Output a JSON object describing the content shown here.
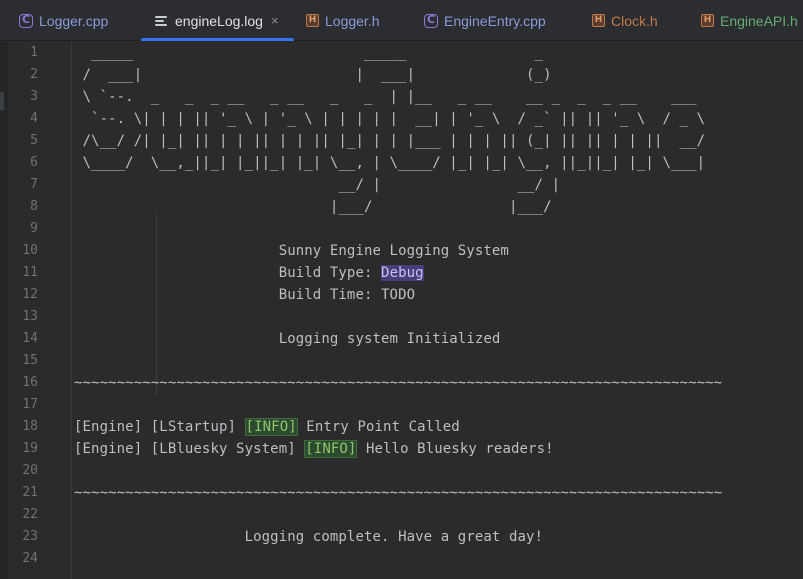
{
  "tabs": [
    {
      "label": "Logger.cpp",
      "type": "cpp",
      "color": "#8b9bd8",
      "active": false
    },
    {
      "label": "engineLog.log",
      "type": "log",
      "color": "#dfe1e5",
      "active": true,
      "close": "×"
    },
    {
      "label": "Logger.h",
      "type": "h",
      "color": "#8b9bd8",
      "active": false
    },
    {
      "label": "EngineEntry.cpp",
      "type": "cpp",
      "color": "#8b9bd8",
      "active": false
    },
    {
      "label": "Clock.h",
      "type": "h",
      "color": "#c07a4a",
      "active": false
    },
    {
      "label": "EngineAPI.h",
      "type": "h",
      "color": "#6aab73",
      "active": false
    }
  ],
  "line_numbers": [
    "1",
    "2",
    "3",
    "4",
    "5",
    "6",
    "7",
    "8",
    "9",
    "10",
    "11",
    "12",
    "13",
    "14",
    "15",
    "16",
    "17",
    "18",
    "19",
    "20",
    "21",
    "22",
    "23",
    "24"
  ],
  "lines": [
    "  _____                           _____               _",
    " /  ___|                         |  ___|             (_)",
    " \\ `--.  _   _  _ __   _ __   _   _  | |__   _ __    __ _  _  _ __    ___",
    "  `--. \\| | | || '_ \\ | '_ \\ | | | | |  __| | '_ \\  / _` || || '_ \\  / _ \\",
    " /\\__/ /| |_| || | | || | | || |_| | | |___ | | | || (_| || || | | ||  __/",
    " \\____/  \\__,_||_| |_||_| |_| \\__, | \\____/ |_| |_| \\__, ||_||_| |_| \\___|",
    "                               __/ |                __/ |",
    "                              |___/                |___/",
    "",
    "                        Sunny Engine Logging System",
    "                        Build Type: ",
    "                        Build Time: TODO",
    "",
    "                        Logging system Initialized",
    "",
    "~~~~~~~~~~~~~~~~~~~~~~~~~~~~~~~~~~~~~~~~~~~~~~~~~~~~~~~~~~~~~~~~~~~~~~~~~~~~",
    "",
    "[Engine] [LStartup] ",
    "[Engine] [LBluesky System] ",
    "",
    "~~~~~~~~~~~~~~~~~~~~~~~~~~~~~~~~~~~~~~~~~~~~~~~~~~~~~~~~~~~~~~~~~~~~~~~~~~~~",
    "",
    "                    Logging complete. Have a great day!",
    ""
  ],
  "highlights": {
    "build_type": "Debug",
    "info_tag": "[INFO]",
    "line18_rest": " Entry Point Called",
    "line19_rest": " Hello Bluesky readers!"
  },
  "colors": {
    "accent": "#3574f0",
    "info_bg": "#2c4a2e",
    "debug_bg": "#4b3d7c"
  }
}
